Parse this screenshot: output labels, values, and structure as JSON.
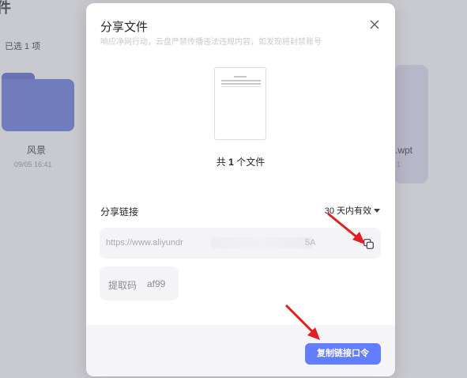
{
  "background": {
    "title": "件",
    "selected_text": "已选 1 项",
    "folder": {
      "name": "风景",
      "date": "09/05 16:41"
    },
    "file": {
      "name": ".wpt",
      "date": "1"
    }
  },
  "modal": {
    "title": "分享文件",
    "subtitle": "响应净网行动，云盘严禁传播违法违规内容，如发现将封禁账号",
    "file_count_prefix": "共",
    "file_count_number": "1",
    "file_count_suffix": "个文件",
    "share_link_label": "分享链接",
    "validity": "30 天内有效",
    "url_visible": "https://www.aliyundr",
    "url_tail": "5A",
    "extract_code_label": "提取码",
    "extract_code": "af99",
    "copy_button": "复制链接口令",
    "icons": {
      "close": "close-icon",
      "copy": "copy-icon",
      "dropdown": "chevron-down-icon"
    },
    "colors": {
      "accent": "#637dff",
      "annotation_arrow": "#e02020"
    }
  }
}
